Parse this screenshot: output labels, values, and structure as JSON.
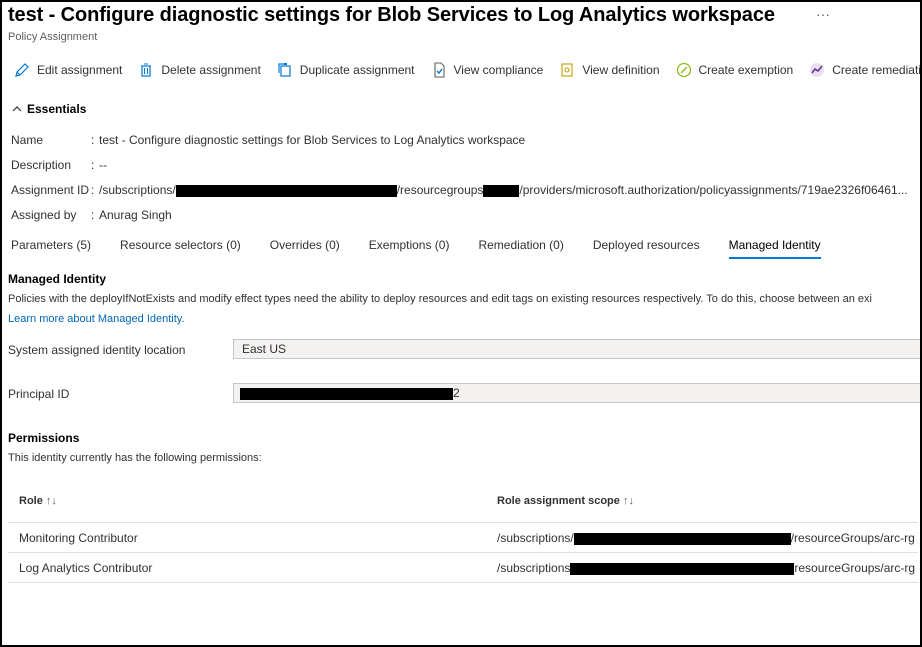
{
  "header": {
    "title": "test - Configure diagnostic settings for Blob Services to Log Analytics workspace",
    "more": "···",
    "subtitle": "Policy Assignment"
  },
  "toolbar": {
    "items": [
      {
        "label": "Edit assignment",
        "icon": "pencil-icon"
      },
      {
        "label": "Delete assignment",
        "icon": "trash-icon"
      },
      {
        "label": "Duplicate assignment",
        "icon": "duplicate-icon"
      },
      {
        "label": "View compliance",
        "icon": "compliance-icon"
      },
      {
        "label": "View definition",
        "icon": "definition-icon"
      },
      {
        "label": "Create exemption",
        "icon": "exemption-icon"
      },
      {
        "label": "Create remediation tas",
        "icon": "remediation-icon"
      }
    ]
  },
  "essentials": {
    "heading": "Essentials",
    "separator": ":",
    "rows": [
      {
        "label": "Name",
        "value": "test - Configure diagnostic settings for Blob Services to Log Analytics workspace"
      },
      {
        "label": "Description",
        "value": "--"
      },
      {
        "label": "Assignment ID",
        "value_parts": [
          "/subscriptions/",
          "/resourcegroups",
          "/providers/microsoft.authorization/policyassignments/719ae2326f06461..."
        ]
      },
      {
        "label": "Assigned by",
        "value": "Anurag Singh"
      }
    ]
  },
  "tabs": [
    {
      "label": "Parameters (5)"
    },
    {
      "label": "Resource selectors (0)"
    },
    {
      "label": "Overrides (0)"
    },
    {
      "label": "Exemptions (0)"
    },
    {
      "label": "Remediation (0)"
    },
    {
      "label": "Deployed resources"
    },
    {
      "label": "Managed Identity",
      "active": true
    }
  ],
  "managed_identity": {
    "heading": "Managed Identity",
    "description": "Policies with the deployIfNotExists and modify effect types need the ability to deploy resources and edit tags on existing resources respectively. To do this, choose between an exi",
    "learn_more": "Learn more about Managed Identity.",
    "location_label": "System assigned identity location",
    "location_value": "East US",
    "principal_label": "Principal ID",
    "principal_suffix": "2"
  },
  "permissions": {
    "heading": "Permissions",
    "description": "This identity currently has the following permissions:",
    "columns": [
      "Role",
      "Role assignment scope"
    ],
    "sort_glyph": "↑↓",
    "rows": [
      {
        "role": "Monitoring Contributor",
        "scope_prefix": "/subscriptions/",
        "scope_suffix": "/resourceGroups/arc-rg"
      },
      {
        "role": "Log Analytics Contributor",
        "scope_prefix": "/subscriptions",
        "scope_suffix": "resourceGroups/arc-rg"
      }
    ]
  },
  "colors": {
    "accent": "#0078d4",
    "link": "#0067b8",
    "field_bg": "#f3f2f1"
  }
}
